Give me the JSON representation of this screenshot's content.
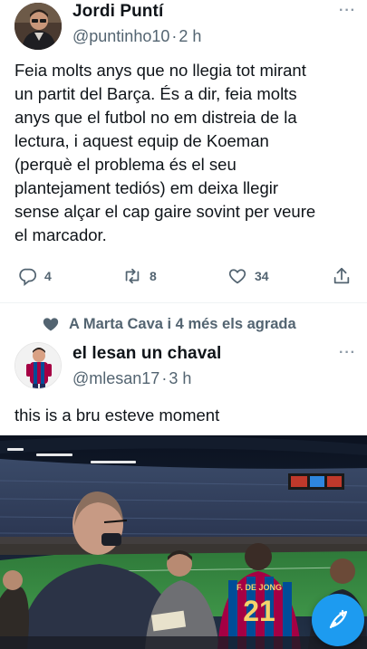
{
  "tweet1": {
    "name": "Jordi Puntí",
    "handle": "@puntinho10",
    "time": "2 h",
    "lines": [
      "Feia molts anys que no llegia tot mirant",
      "un partit del Barça. És a dir, feia molts",
      "anys que el futbol no em distreia de la",
      "lectura, i aquest equip de Koeman",
      "(perquè el problema és el seu",
      "plantejament tediós) em deixa llegir",
      "sense alçar el cap gaire sovint per veure",
      "el marcador."
    ],
    "replies": "4",
    "retweets": "8",
    "likes": "34"
  },
  "social_context": "A Marta Cava i 4 més els agrada",
  "tweet2": {
    "name": "el lesan un chaval",
    "handle": "@mlesan17",
    "time": "3 h",
    "text": "this is a bru esteve moment",
    "shirt_number": "21",
    "shirt_name": "F. DE JONG"
  },
  "dot": "·",
  "more": "···",
  "colors": {
    "accent": "#1d9bf0",
    "muted": "#536471",
    "text": "#0f1419",
    "divider": "#eff3f4"
  },
  "icons": [
    "reply-icon",
    "retweet-icon",
    "like-icon",
    "share-icon",
    "heart-filled-icon",
    "compose-tweet-icon",
    "more-icon"
  ]
}
